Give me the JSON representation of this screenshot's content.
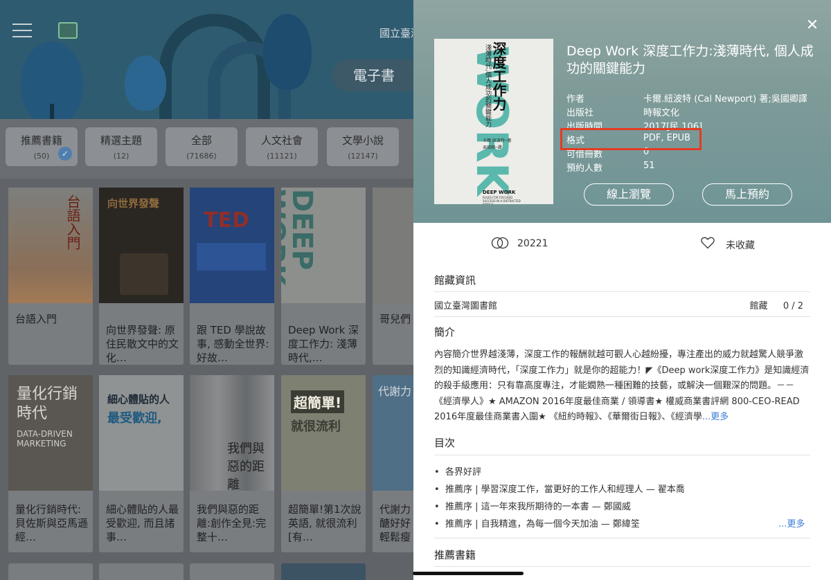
{
  "background": {
    "header": {
      "library_title": "國立臺灣",
      "ebook_label": "電子書"
    },
    "categories": [
      {
        "name": "推薦書籍",
        "count": "(50)",
        "selected": true
      },
      {
        "name": "精選主題",
        "count": "(12)",
        "selected": false
      },
      {
        "name": "全部",
        "count": "(71686)",
        "selected": false
      },
      {
        "name": "人文社會",
        "count": "(11121)",
        "selected": false
      },
      {
        "name": "文學小說",
        "count": "(12147)",
        "selected": false
      }
    ],
    "books": [
      {
        "title": "台語入門",
        "cover_text": "台語入門"
      },
      {
        "title": "向世界發聲: 原住民散文中的文化…",
        "cover_text": "向世界發聲"
      },
      {
        "title": "跟 TED 學說故事, 感動全世界:好故…",
        "cover_text": "TED"
      },
      {
        "title": "Deep Work 深度工作力: 淺薄時代,…",
        "cover_text": "DEEP WORK"
      },
      {
        "title": "哥兒們",
        "cover_text": ""
      },
      {
        "title": "量化行銷時代:貝佐斯與亞馬遜經…",
        "cover_text": "量化行銷時代"
      },
      {
        "title": "細心體貼的人最受歡迎, 而且諸事…",
        "cover_text": "細心體貼的人"
      },
      {
        "title": "我們與惡的距離:創作全見:完整十…",
        "cover_text": "我們與惡的距離"
      },
      {
        "title": "超簡單!第1次說英語, 就很流利 [有…",
        "cover_text": "超簡單!"
      },
      {
        "title": "代謝力 醣好好 輕鬆瘦",
        "cover_text": "代謝力"
      }
    ]
  },
  "detail": {
    "title": "Deep Work 深度工作力:淺薄時代, 個人成功的關鍵能力",
    "cover": {
      "big_text": "DEEP WORK",
      "cn_title": "深度工作力",
      "subtitle": "淺薄時代,個人成功的關鍵能力",
      "author_line": "卡爾.紐波特─著",
      "translator_line": "吳國卿─譯",
      "en_title": "DEEP WORK",
      "en_sub": "RULES FOR FOCUSED SUCCESS IN A DISTRACTED WORLD"
    },
    "meta": [
      {
        "key": "作者",
        "value": "卡爾.紐波特 (Cal Newport) 著;吳國卿譯"
      },
      {
        "key": "出版社",
        "value": "時報文化"
      },
      {
        "key": "出版時間",
        "value": "2017[民 106]"
      },
      {
        "key": "格式",
        "value": "PDF, EPUB"
      },
      {
        "key": "可借冊數",
        "value": "0"
      },
      {
        "key": "預約人數",
        "value": "51"
      }
    ],
    "buttons": {
      "browse": "線上瀏覽",
      "reserve": "馬上預約"
    },
    "stats": {
      "views": "20221",
      "favorite": "未收藏"
    },
    "holdings": {
      "heading": "館藏資訊",
      "library": "國立臺灣圖書館",
      "label": "館藏",
      "count": "0 / 2"
    },
    "intro": {
      "heading": "簡介",
      "text": "內容簡介世界越淺薄，深度工作的報酬就越可觀人心越紛擾，專注產出的威力就越驚人競爭激烈的知識經濟時代，「深度工作力」就是你的超能力！◤《Deep work深度工作力》是知識經濟的殺手級應用：只有靠高度專注，才能嫺熟一種困難的技藝，或解決一個艱深的問題。－－《經濟學人》★ AMAZON 2016年度最佳商業 / 領導書★ 權威商業書評網 800-CEO-READ 2016年度最佳商業書入圍★ 《紐約時報》、《華爾街日報》、《經濟學",
      "more": "...更多"
    },
    "toc": {
      "heading": "目次",
      "items": [
        "各界好評",
        "推薦序 | 學習深度工作，當更好的工作人和經理人 — 翟本喬",
        "推薦序 | 這一年來我所期待的一本書 — 鄭國威",
        "推薦序 | 自我精進，為每一個今天加油 — 鄭緯筌"
      ],
      "more": "...更多"
    },
    "recommended_heading": "推薦書籍",
    "colors": {
      "accent": "#3a7bd5",
      "highlight": "#e53a22",
      "cover_teal": "#5ab8ac"
    }
  }
}
